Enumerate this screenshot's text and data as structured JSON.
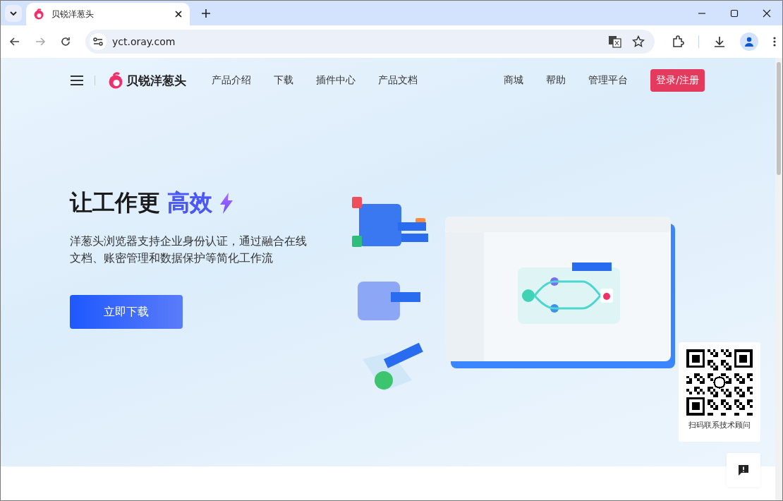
{
  "browser": {
    "tab": {
      "title": "贝锐洋葱头",
      "selected": true
    },
    "url": "yct.oray.com"
  },
  "header": {
    "brand": "贝锐洋葱头",
    "nav": [
      "产品介绍",
      "下载",
      "插件中心",
      "产品文档"
    ],
    "nav_right": [
      "商城",
      "帮助",
      "管理平台"
    ],
    "login": "登录/注册"
  },
  "hero": {
    "title": "让工作更",
    "title_highlight": "高效",
    "subtitle": "洋葱头浏览器支持企业身份认证，通过融合在线文档、账密管理和数据保护等简化工作流",
    "download": "立即下载"
  },
  "qr": {
    "caption": "扫码联系技术顾问"
  }
}
